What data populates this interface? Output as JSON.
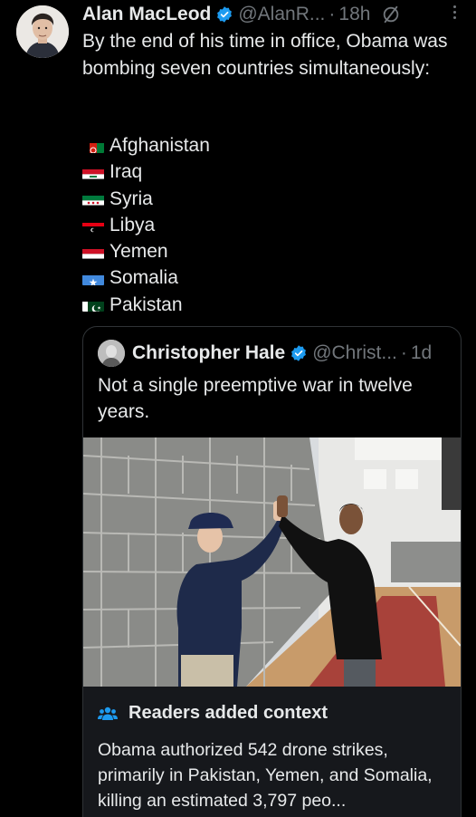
{
  "author": {
    "name": "Alan MacLeod",
    "handle": "@AlanR...",
    "time": "18h",
    "separator": "·"
  },
  "tweet": {
    "text": "By the end of his time in office, Obama was bombing seven countries simultaneously:",
    "countries": [
      {
        "name": "Afghanistan",
        "flag": "afghanistan-flag-icon"
      },
      {
        "name": "Iraq",
        "flag": "iraq-flag-icon"
      },
      {
        "name": "Syria",
        "flag": "syria-flag-icon"
      },
      {
        "name": "Libya",
        "flag": "libya-flag-icon"
      },
      {
        "name": "Yemen",
        "flag": "yemen-flag-icon"
      },
      {
        "name": "Somalia",
        "flag": "somalia-flag-icon"
      },
      {
        "name": "Pakistan",
        "flag": "pakistan-flag-icon"
      }
    ]
  },
  "quote": {
    "name": "Christopher Hale",
    "handle": "@Christ...",
    "time": "1d",
    "separator": "·",
    "text": "Not a single preemptive war in twelve years."
  },
  "context": {
    "title": "Readers added context",
    "text": "Obama authorized 542 drone strikes, primarily in Pakistan, Yemen, and Somalia, killing an estimated 3,797 peo..."
  },
  "colors": {
    "background": "#000000",
    "text": "#e7e9ea",
    "muted": "#71767b",
    "verified": "#1d9bf0",
    "context_bg": "#16181c",
    "context_icon": "#1d9bf0"
  }
}
